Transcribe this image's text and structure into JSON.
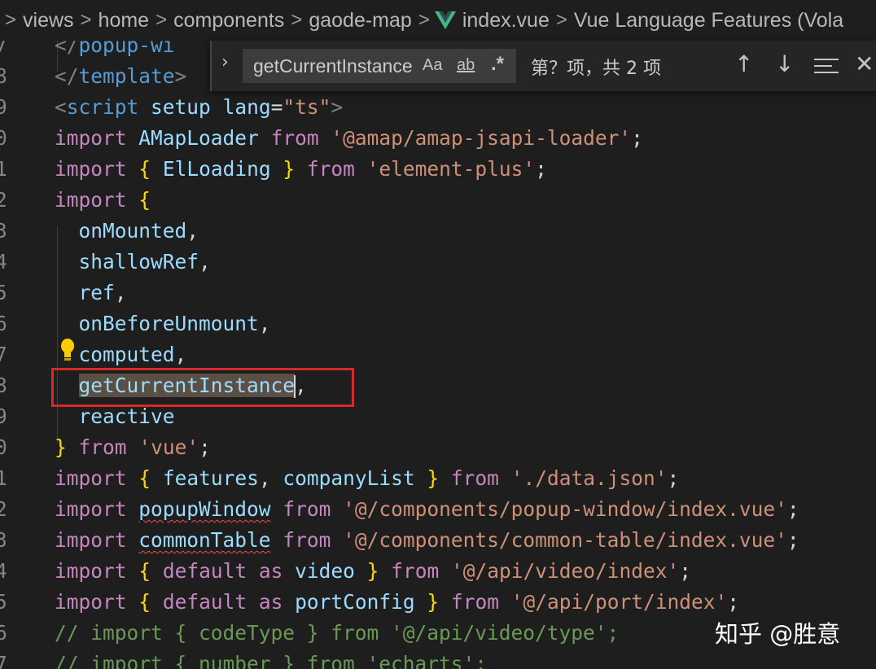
{
  "breadcrumb": {
    "items": [
      "views",
      "home",
      "components",
      "gaode-map",
      "index.vue",
      "Vue Language Features (Vola"
    ],
    "separator": ">"
  },
  "find_widget": {
    "toggle": "›",
    "query": "getCurrentInstance",
    "match_case": "Aa",
    "whole_word": "ab",
    "regex": ".*",
    "count": "第？项，共 2 项",
    "prev_icon": "arrow-up-icon",
    "next_icon": "arrow-down-icon",
    "selection_icon": "find-in-selection-icon",
    "close_icon": "close-icon"
  },
  "lines": [
    {
      "ln": "7",
      "parts": [
        [
          "</",
          "dim"
        ],
        [
          "popup-wi",
          "tag"
        ]
      ]
    },
    {
      "ln": "8",
      "parts": [
        [
          "</",
          "dim"
        ],
        [
          "template",
          "tag"
        ],
        [
          ">",
          "dim"
        ]
      ]
    },
    {
      "ln": "9",
      "parts": [
        [
          "<",
          "dim"
        ],
        [
          "script",
          "tag"
        ],
        [
          " ",
          "punc"
        ],
        [
          "setup",
          "attr"
        ],
        [
          " ",
          "punc"
        ],
        [
          "lang",
          "attr"
        ],
        [
          "=",
          "punc"
        ],
        [
          "\"ts\"",
          "str"
        ],
        [
          ">",
          "dim"
        ]
      ]
    },
    {
      "ln": "0",
      "parts": [
        [
          "import",
          "kw"
        ],
        [
          " ",
          "punc"
        ],
        [
          "AMapLoader",
          "id"
        ],
        [
          " ",
          "punc"
        ],
        [
          "from",
          "kw"
        ],
        [
          " ",
          "punc"
        ],
        [
          "'@amap/amap-jsapi-loader'",
          "str"
        ],
        [
          ";",
          "punc"
        ]
      ]
    },
    {
      "ln": "1",
      "parts": [
        [
          "import",
          "kw"
        ],
        [
          " ",
          "punc"
        ],
        [
          "{",
          "brace"
        ],
        [
          " ",
          "punc"
        ],
        [
          "ElLoading",
          "id"
        ],
        [
          " ",
          "punc"
        ],
        [
          "}",
          "brace"
        ],
        [
          " ",
          "punc"
        ],
        [
          "from",
          "kw"
        ],
        [
          " ",
          "punc"
        ],
        [
          "'element-plus'",
          "str"
        ],
        [
          ";",
          "punc"
        ]
      ]
    },
    {
      "ln": "2",
      "parts": [
        [
          "import",
          "kw"
        ],
        [
          " ",
          "punc"
        ],
        [
          "{",
          "brace"
        ]
      ]
    },
    {
      "ln": "3",
      "parts": [
        [
          "  ",
          "punc"
        ],
        [
          "onMounted",
          "id"
        ],
        [
          ",",
          "punc"
        ]
      ]
    },
    {
      "ln": "4",
      "parts": [
        [
          "  ",
          "punc"
        ],
        [
          "shallowRef",
          "id"
        ],
        [
          ",",
          "punc"
        ]
      ]
    },
    {
      "ln": "5",
      "parts": [
        [
          "  ",
          "punc"
        ],
        [
          "ref",
          "id"
        ],
        [
          ",",
          "punc"
        ]
      ]
    },
    {
      "ln": "6",
      "parts": [
        [
          "  ",
          "punc"
        ],
        [
          "onBeforeUnmount",
          "id"
        ],
        [
          ",",
          "punc"
        ]
      ]
    },
    {
      "ln": "7",
      "parts": [
        [
          "  ",
          "punc"
        ],
        [
          "computed",
          "id"
        ],
        [
          ",",
          "punc"
        ]
      ]
    },
    {
      "ln": "8",
      "parts": [
        [
          "  ",
          "punc"
        ],
        [
          "getCurrentInstance",
          "id hl"
        ],
        [
          "",
          "cursor"
        ],
        [
          ",",
          "punc"
        ]
      ]
    },
    {
      "ln": "9",
      "parts": [
        [
          "  ",
          "punc"
        ],
        [
          "reactive",
          "id"
        ]
      ]
    },
    {
      "ln": "0",
      "parts": [
        [
          "}",
          "brace"
        ],
        [
          " ",
          "punc"
        ],
        [
          "from",
          "kw"
        ],
        [
          " ",
          "punc"
        ],
        [
          "'vue'",
          "str"
        ],
        [
          ";",
          "punc"
        ]
      ]
    },
    {
      "ln": "1",
      "parts": [
        [
          "import",
          "kw"
        ],
        [
          " ",
          "punc"
        ],
        [
          "{",
          "brace"
        ],
        [
          " ",
          "punc"
        ],
        [
          "features",
          "id"
        ],
        [
          ", ",
          "punc"
        ],
        [
          "companyList",
          "id"
        ],
        [
          " ",
          "punc"
        ],
        [
          "}",
          "brace"
        ],
        [
          " ",
          "punc"
        ],
        [
          "from",
          "kw"
        ],
        [
          " ",
          "punc"
        ],
        [
          "'./data.json'",
          "str"
        ],
        [
          ";",
          "punc"
        ]
      ]
    },
    {
      "ln": "2",
      "parts": [
        [
          "import",
          "kw"
        ],
        [
          " ",
          "punc"
        ],
        [
          "popupWindow",
          "id squiggle"
        ],
        [
          " ",
          "punc"
        ],
        [
          "from",
          "kw"
        ],
        [
          " ",
          "punc"
        ],
        [
          "'@/components/popup-window/index.vue'",
          "str"
        ],
        [
          ";",
          "punc"
        ]
      ]
    },
    {
      "ln": "3",
      "parts": [
        [
          "import",
          "kw"
        ],
        [
          " ",
          "punc"
        ],
        [
          "commonTable",
          "id squiggle"
        ],
        [
          " ",
          "punc"
        ],
        [
          "from",
          "kw"
        ],
        [
          " ",
          "punc"
        ],
        [
          "'@/components/common-table/index.vue'",
          "str"
        ],
        [
          ";",
          "punc"
        ]
      ]
    },
    {
      "ln": "4",
      "parts": [
        [
          "import",
          "kw"
        ],
        [
          " ",
          "punc"
        ],
        [
          "{",
          "brace"
        ],
        [
          " ",
          "punc"
        ],
        [
          "default",
          "kw"
        ],
        [
          " ",
          "punc"
        ],
        [
          "as",
          "kw"
        ],
        [
          " ",
          "punc"
        ],
        [
          "video",
          "id"
        ],
        [
          " ",
          "punc"
        ],
        [
          "}",
          "brace"
        ],
        [
          " ",
          "punc"
        ],
        [
          "from",
          "kw"
        ],
        [
          " ",
          "punc"
        ],
        [
          "'@/api/video/index'",
          "str"
        ],
        [
          ";",
          "punc"
        ]
      ]
    },
    {
      "ln": "5",
      "parts": [
        [
          "import",
          "kw"
        ],
        [
          " ",
          "punc"
        ],
        [
          "{",
          "brace"
        ],
        [
          " ",
          "punc"
        ],
        [
          "default",
          "kw"
        ],
        [
          " ",
          "punc"
        ],
        [
          "as",
          "kw"
        ],
        [
          " ",
          "punc"
        ],
        [
          "portConfig",
          "id"
        ],
        [
          " ",
          "punc"
        ],
        [
          "}",
          "brace"
        ],
        [
          " ",
          "punc"
        ],
        [
          "from",
          "kw"
        ],
        [
          " ",
          "punc"
        ],
        [
          "'@/api/port/index'",
          "str"
        ],
        [
          ";",
          "punc"
        ]
      ]
    },
    {
      "ln": "6",
      "parts": [
        [
          "// import { codeType } from '@/api/video/type';",
          "comment"
        ]
      ]
    },
    {
      "ln": "7",
      "parts": [
        [
          "// import { number } from 'echarts';",
          "comment"
        ]
      ]
    }
  ],
  "watermark": "知乎 @胜意"
}
